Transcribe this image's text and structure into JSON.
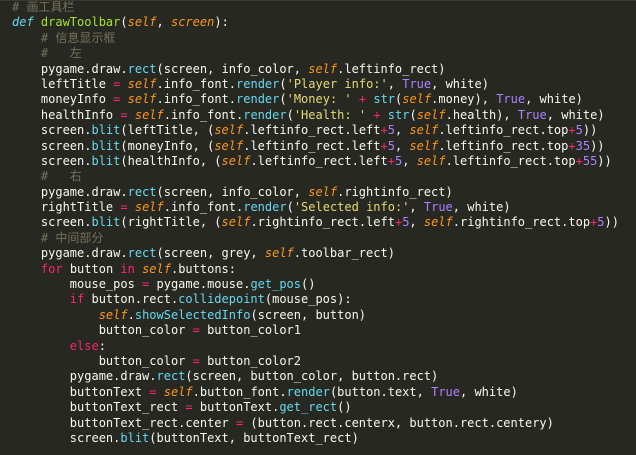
{
  "editor": {
    "language": "python",
    "theme_colors": {
      "background": "#272822",
      "comment": "#75715e",
      "keyword": "#f92672",
      "function_name": "#a6e22e",
      "self_param": "#fd971f",
      "string": "#e6db74",
      "number": "#ae81ff",
      "builtin": "#66d9ef",
      "plain": "#f8f8f2"
    },
    "lines": [
      [
        [
          "comment",
          "# 画工具栏"
        ]
      ],
      [
        [
          "def",
          "def "
        ],
        [
          "funcname",
          "drawToolbar"
        ],
        [
          "plain",
          "("
        ],
        [
          "param",
          "self"
        ],
        [
          "plain",
          ", "
        ],
        [
          "param",
          "screen"
        ],
        [
          "plain",
          "):"
        ]
      ],
      [
        [
          "plain",
          "    "
        ],
        [
          "comment",
          "# 信息显示框"
        ]
      ],
      [
        [
          "plain",
          "    "
        ],
        [
          "comment",
          "#   左"
        ]
      ],
      [
        [
          "plain",
          "    pygame.draw."
        ],
        [
          "call",
          "rect"
        ],
        [
          "plain",
          "(screen, info_color, "
        ],
        [
          "self",
          "self"
        ],
        [
          "plain",
          ".leftinfo_rect)"
        ]
      ],
      [
        [
          "plain",
          "    leftTitle "
        ],
        [
          "op",
          "="
        ],
        [
          "plain",
          " "
        ],
        [
          "self",
          "self"
        ],
        [
          "plain",
          ".info_font."
        ],
        [
          "call",
          "render"
        ],
        [
          "plain",
          "("
        ],
        [
          "string",
          "'Player info:'"
        ],
        [
          "plain",
          ", "
        ],
        [
          "const",
          "True"
        ],
        [
          "plain",
          ", white)"
        ]
      ],
      [
        [
          "plain",
          "    moneyInfo "
        ],
        [
          "op",
          "="
        ],
        [
          "plain",
          " "
        ],
        [
          "self",
          "self"
        ],
        [
          "plain",
          ".info_font."
        ],
        [
          "call",
          "render"
        ],
        [
          "plain",
          "("
        ],
        [
          "string",
          "'Money: '"
        ],
        [
          "plain",
          " "
        ],
        [
          "op",
          "+"
        ],
        [
          "plain",
          " "
        ],
        [
          "builtin",
          "str"
        ],
        [
          "plain",
          "("
        ],
        [
          "self",
          "self"
        ],
        [
          "plain",
          ".money), "
        ],
        [
          "const",
          "True"
        ],
        [
          "plain",
          ", white)"
        ]
      ],
      [
        [
          "plain",
          "    healthInfo "
        ],
        [
          "op",
          "="
        ],
        [
          "plain",
          " "
        ],
        [
          "self",
          "self"
        ],
        [
          "plain",
          ".info_font."
        ],
        [
          "call",
          "render"
        ],
        [
          "plain",
          "("
        ],
        [
          "string",
          "'Health: '"
        ],
        [
          "plain",
          " "
        ],
        [
          "op",
          "+"
        ],
        [
          "plain",
          " "
        ],
        [
          "builtin",
          "str"
        ],
        [
          "plain",
          "("
        ],
        [
          "self",
          "self"
        ],
        [
          "plain",
          ".health), "
        ],
        [
          "const",
          "True"
        ],
        [
          "plain",
          ", white)"
        ]
      ],
      [
        [
          "plain",
          "    screen."
        ],
        [
          "call",
          "blit"
        ],
        [
          "plain",
          "(leftTitle, ("
        ],
        [
          "self",
          "self"
        ],
        [
          "plain",
          ".leftinfo_rect.left"
        ],
        [
          "op",
          "+"
        ],
        [
          "number",
          "5"
        ],
        [
          "plain",
          ", "
        ],
        [
          "self",
          "self"
        ],
        [
          "plain",
          ".leftinfo_rect.top"
        ],
        [
          "op",
          "+"
        ],
        [
          "number",
          "5"
        ],
        [
          "plain",
          "))"
        ]
      ],
      [
        [
          "plain",
          "    screen."
        ],
        [
          "call",
          "blit"
        ],
        [
          "plain",
          "(moneyInfo, ("
        ],
        [
          "self",
          "self"
        ],
        [
          "plain",
          ".leftinfo_rect.left"
        ],
        [
          "op",
          "+"
        ],
        [
          "number",
          "5"
        ],
        [
          "plain",
          ", "
        ],
        [
          "self",
          "self"
        ],
        [
          "plain",
          ".leftinfo_rect.top"
        ],
        [
          "op",
          "+"
        ],
        [
          "number",
          "35"
        ],
        [
          "plain",
          "))"
        ]
      ],
      [
        [
          "plain",
          "    screen."
        ],
        [
          "call",
          "blit"
        ],
        [
          "plain",
          "(healthInfo, ("
        ],
        [
          "self",
          "self"
        ],
        [
          "plain",
          ".leftinfo_rect.left"
        ],
        [
          "op",
          "+"
        ],
        [
          "number",
          "5"
        ],
        [
          "plain",
          ", "
        ],
        [
          "self",
          "self"
        ],
        [
          "plain",
          ".leftinfo_rect.top"
        ],
        [
          "op",
          "+"
        ],
        [
          "number",
          "55"
        ],
        [
          "plain",
          "))"
        ]
      ],
      [
        [
          "plain",
          "    "
        ],
        [
          "comment",
          "#   右"
        ]
      ],
      [
        [
          "plain",
          "    pygame.draw."
        ],
        [
          "call",
          "rect"
        ],
        [
          "plain",
          "(screen, info_color, "
        ],
        [
          "self",
          "self"
        ],
        [
          "plain",
          ".rightinfo_rect)"
        ]
      ],
      [
        [
          "plain",
          "    rightTitle "
        ],
        [
          "op",
          "="
        ],
        [
          "plain",
          " "
        ],
        [
          "self",
          "self"
        ],
        [
          "plain",
          ".info_font."
        ],
        [
          "call",
          "render"
        ],
        [
          "plain",
          "("
        ],
        [
          "string",
          "'Selected info:'"
        ],
        [
          "plain",
          ", "
        ],
        [
          "const",
          "True"
        ],
        [
          "plain",
          ", white)"
        ]
      ],
      [
        [
          "plain",
          "    screen."
        ],
        [
          "call",
          "blit"
        ],
        [
          "plain",
          "(rightTitle, ("
        ],
        [
          "self",
          "self"
        ],
        [
          "plain",
          ".rightinfo_rect.left"
        ],
        [
          "op",
          "+"
        ],
        [
          "number",
          "5"
        ],
        [
          "plain",
          ", "
        ],
        [
          "self",
          "self"
        ],
        [
          "plain",
          ".rightinfo_rect.top"
        ],
        [
          "op",
          "+"
        ],
        [
          "number",
          "5"
        ],
        [
          "plain",
          "))"
        ]
      ],
      [
        [
          "plain",
          "    "
        ],
        [
          "comment",
          "# 中间部分"
        ]
      ],
      [
        [
          "plain",
          "    pygame.draw."
        ],
        [
          "call",
          "rect"
        ],
        [
          "plain",
          "(screen, grey, "
        ],
        [
          "self",
          "self"
        ],
        [
          "plain",
          ".toolbar_rect)"
        ]
      ],
      [
        [
          "plain",
          "    "
        ],
        [
          "keyword",
          "for"
        ],
        [
          "plain",
          " button "
        ],
        [
          "keyword",
          "in"
        ],
        [
          "plain",
          " "
        ],
        [
          "self",
          "self"
        ],
        [
          "plain",
          ".buttons:"
        ]
      ],
      [
        [
          "plain",
          "        mouse_pos "
        ],
        [
          "op",
          "="
        ],
        [
          "plain",
          " pygame.mouse."
        ],
        [
          "call",
          "get_pos"
        ],
        [
          "plain",
          "()"
        ]
      ],
      [
        [
          "plain",
          "        "
        ],
        [
          "keyword",
          "if"
        ],
        [
          "plain",
          " button.rect."
        ],
        [
          "call",
          "collidepoint"
        ],
        [
          "plain",
          "(mouse_pos):"
        ]
      ],
      [
        [
          "plain",
          "            "
        ],
        [
          "self",
          "self"
        ],
        [
          "plain",
          "."
        ],
        [
          "call",
          "showSelectedInfo"
        ],
        [
          "plain",
          "(screen, button)"
        ]
      ],
      [
        [
          "plain",
          "            button_color "
        ],
        [
          "op",
          "="
        ],
        [
          "plain",
          " button_color1"
        ]
      ],
      [
        [
          "plain",
          "        "
        ],
        [
          "keyword",
          "else"
        ],
        [
          "plain",
          ":"
        ]
      ],
      [
        [
          "plain",
          "            button_color "
        ],
        [
          "op",
          "="
        ],
        [
          "plain",
          " button_color2"
        ]
      ],
      [
        [
          "plain",
          "        pygame.draw."
        ],
        [
          "call",
          "rect"
        ],
        [
          "plain",
          "(screen, button_color, button.rect)"
        ]
      ],
      [
        [
          "plain",
          "        buttonText "
        ],
        [
          "op",
          "="
        ],
        [
          "plain",
          " "
        ],
        [
          "self",
          "self"
        ],
        [
          "plain",
          ".button_font."
        ],
        [
          "call",
          "render"
        ],
        [
          "plain",
          "(button.text, "
        ],
        [
          "const",
          "True"
        ],
        [
          "plain",
          ", white)"
        ]
      ],
      [
        [
          "plain",
          "        buttonText_rect "
        ],
        [
          "op",
          "="
        ],
        [
          "plain",
          " buttonText."
        ],
        [
          "call",
          "get_rect"
        ],
        [
          "plain",
          "()"
        ]
      ],
      [
        [
          "plain",
          "        buttonText_rect.center "
        ],
        [
          "op",
          "="
        ],
        [
          "plain",
          " (button.rect.centerx, button.rect.centery)"
        ]
      ],
      [
        [
          "plain",
          "        screen."
        ],
        [
          "call",
          "blit"
        ],
        [
          "plain",
          "(buttonText, buttonText_rect)"
        ]
      ]
    ]
  }
}
